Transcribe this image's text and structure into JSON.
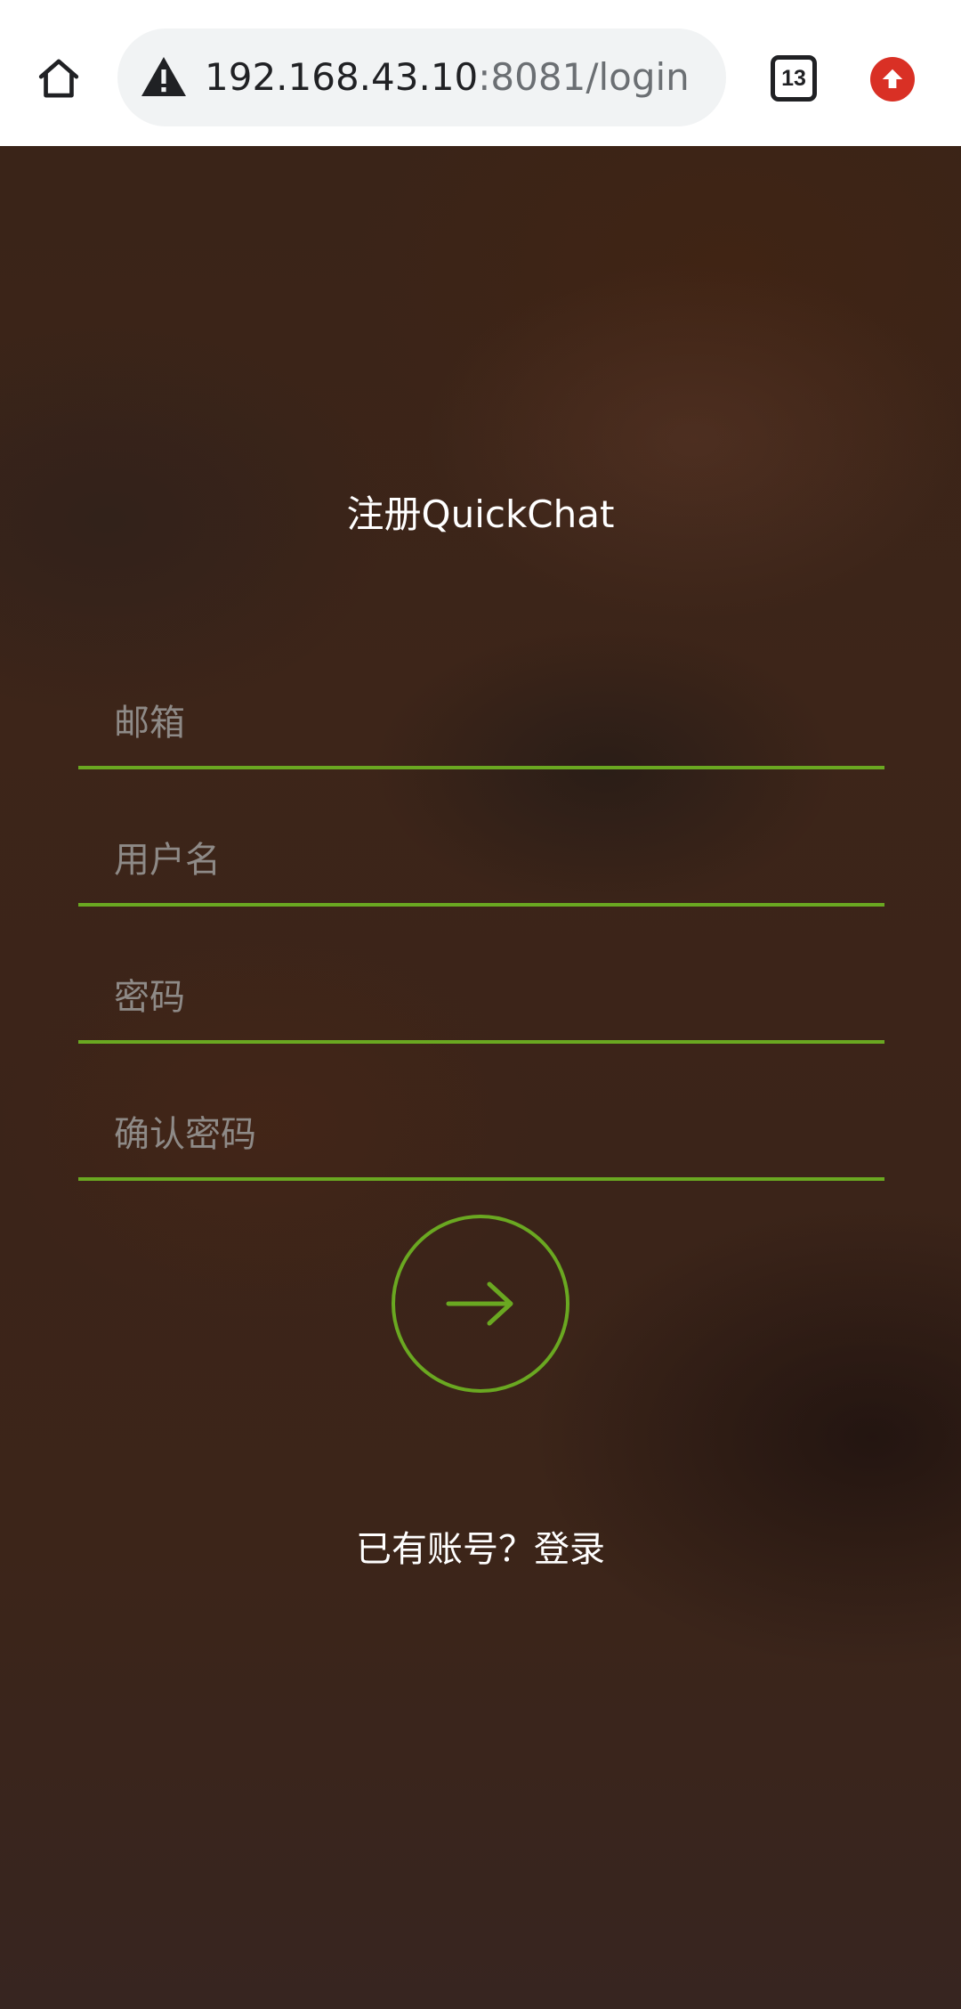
{
  "browser": {
    "url_host": "192.168.43.10",
    "url_rest": ":8081/login",
    "tab_count": "13",
    "icons": {
      "home": "home-icon",
      "security": "not-secure-warning-icon",
      "update": "update-arrow-icon"
    },
    "colors": {
      "update_badge": "#d93025"
    }
  },
  "page": {
    "title": "注册QuickChat",
    "fields": {
      "email_placeholder": "邮箱",
      "username_placeholder": "用户名",
      "password_placeholder": "密码",
      "confirm_password_placeholder": "确认密码"
    },
    "submit_icon": "arrow-right-icon",
    "login_link": "已有账号？登录",
    "colors": {
      "accent": "#6aa821",
      "background": "#3b2419",
      "text": "#ffffff",
      "placeholder": "#8e8a87"
    }
  }
}
